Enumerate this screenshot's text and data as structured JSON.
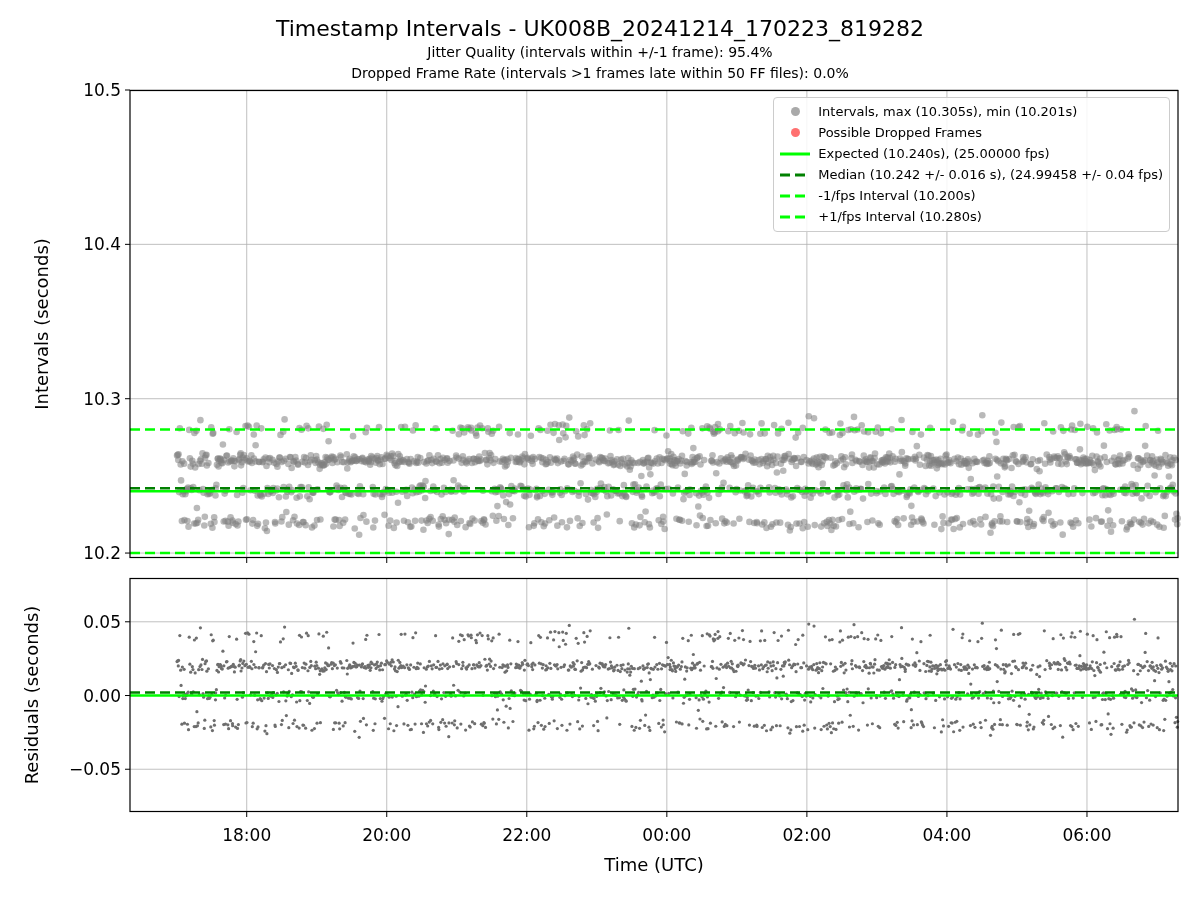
{
  "figure": {
    "title": "Timestamp Intervals - UK008B_20241214_170223_819282",
    "subtitles": [
      "Jitter Quality (intervals within +/-1 frame): 95.4%",
      "Dropped Frame Rate (intervals >1 frames late within 50 FF files): 0.0%"
    ]
  },
  "intervals_plot": {
    "legend": [
      {
        "label": "Intervals, max (10.305s), min (10.201s)",
        "color": "#a9a9a9"
      },
      {
        "label": "Possible Dropped Frames",
        "color": "#ff7070"
      }
    ],
    "chart_data": {
      "type": "line",
      "ylabel": "Intervals (seconds)",
      "grid": true,
      "x": [
        "2024-12-14T16:20:00Z",
        "2024-12-15T07:18:00Z"
      ],
      "xlim": [
        "2024-12-14T16:20:00Z",
        "2024-12-15T07:18:00Z"
      ],
      "ylim": [
        10.1968,
        10.5
      ],
      "yticks": [
        {
          "value": 10.2,
          "label": "10.2"
        },
        {
          "value": 10.3,
          "label": "10.3"
        },
        {
          "value": 10.4,
          "label": "10.4"
        },
        {
          "value": 10.5,
          "label": "10.5"
        }
      ],
      "series": [
        {
          "name": "Expected (10.240s), (25.00000 fps)",
          "color": "#00ff00",
          "values": [
            10.24,
            10.24
          ],
          "line_style": "solid"
        },
        {
          "name": "Median (10.242 +/- 0.016 s), (24.99458 +/- 0.04 fps)",
          "color": "#008000",
          "values": [
            10.242,
            10.242
          ],
          "line_style": "dashed"
        },
        {
          "name": "-1/fps Interval (10.200s)",
          "color": "#00ff00",
          "values": [
            10.2,
            10.2
          ],
          "line_style": "dashed"
        },
        {
          "name": "+1/fps Interval (10.280s)",
          "color": "#00ff00",
          "values": [
            10.28,
            10.28
          ],
          "line_style": "dashed"
        }
      ]
    }
  },
  "residuals_plot": {
    "chart_data": {
      "type": "line",
      "xlabel": "Time (UTC)",
      "ylabel": "Residuals (seconds)",
      "grid": true,
      "x": [
        "2024-12-14T16:20:00Z",
        "2024-12-15T07:18:00Z"
      ],
      "xlim": [
        "2024-12-14T16:20:00Z",
        "2024-12-15T07:18:00Z"
      ],
      "ylim": [
        -0.079,
        0.0797
      ],
      "yticks": [
        {
          "value": -0.05,
          "label": "−0.05"
        },
        {
          "value": 0,
          "label": "0.00"
        },
        {
          "value": 0.05,
          "label": "0.05"
        }
      ],
      "xticks": [
        {
          "value": "2024-12-14T18:00:00Z",
          "label": "18:00"
        },
        {
          "value": "2024-12-14T20:00:00Z",
          "label": "20:00"
        },
        {
          "value": "2024-12-14T22:00:00Z",
          "label": "22:00"
        },
        {
          "value": "2024-12-15T00:00:00Z",
          "label": "00:00"
        },
        {
          "value": "2024-12-15T02:00:00Z",
          "label": "02:00"
        },
        {
          "value": "2024-12-15T04:00:00Z",
          "label": "04:00"
        },
        {
          "value": "2024-12-15T06:00:00Z",
          "label": "06:00"
        }
      ],
      "series": [
        {
          "color": "#00ff00",
          "values": [
            0,
            0
          ],
          "line_style": "solid"
        },
        {
          "color": "#008000",
          "values": [
            0.002,
            0.002
          ],
          "line_style": "dashed"
        }
      ]
    }
  }
}
